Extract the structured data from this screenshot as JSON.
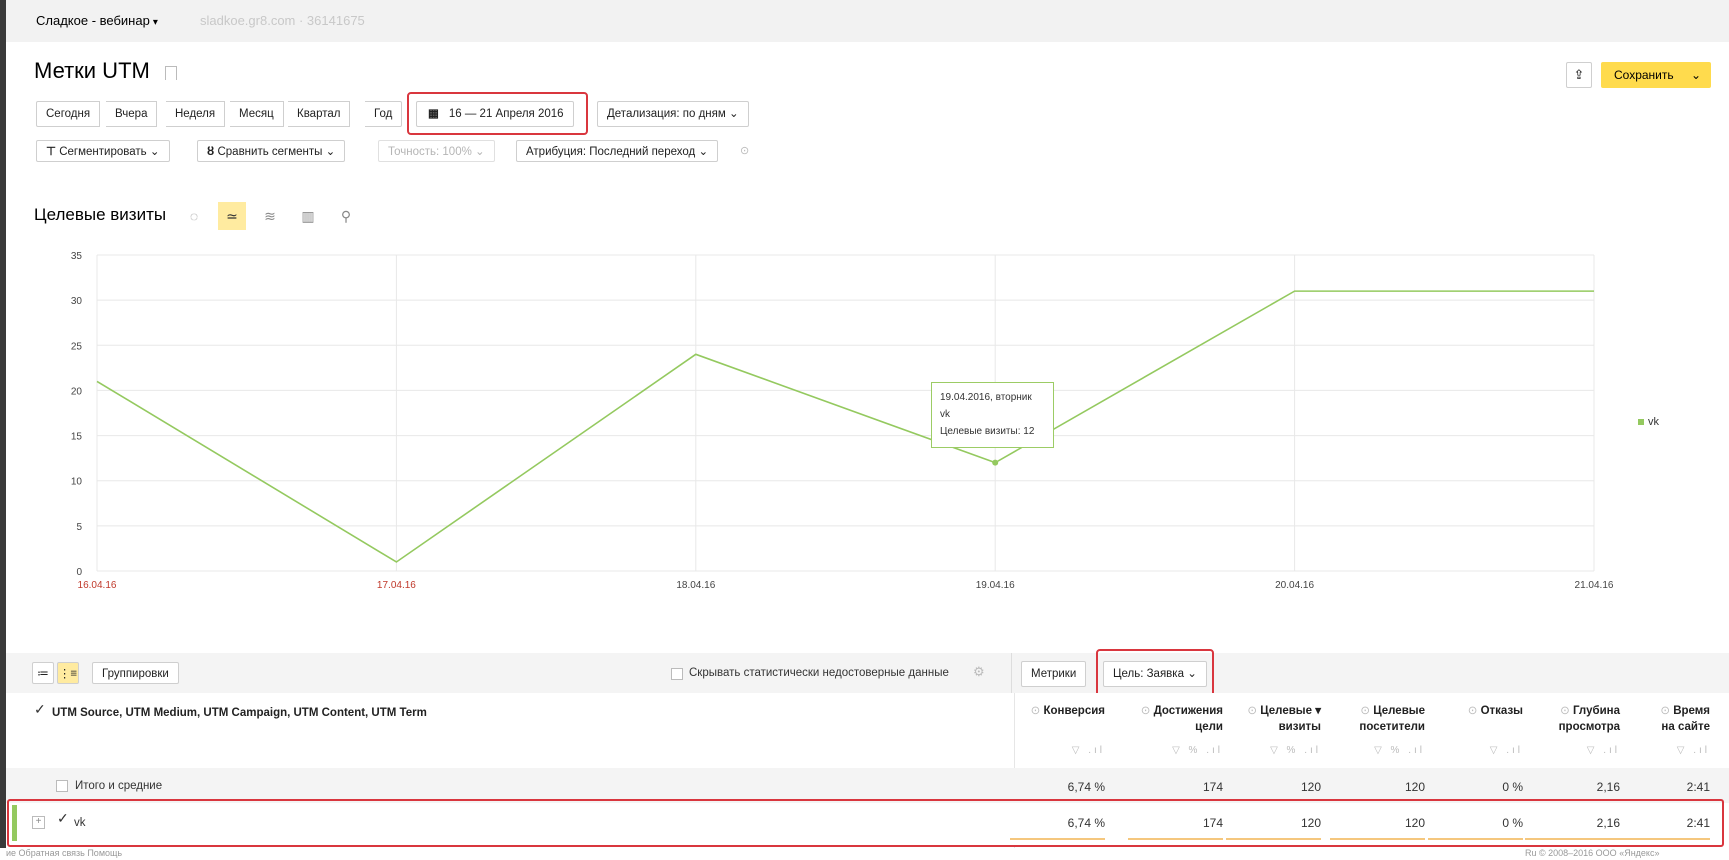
{
  "site": {
    "name": "Сладкое - вебинар",
    "meta": "sladkoe.gr8.com  ·  36141675"
  },
  "page": {
    "title": "Метки UTM"
  },
  "actions": {
    "save_label": "Сохранить"
  },
  "periods": [
    "Сегодня",
    "Вчера",
    "Неделя",
    "Месяц",
    "Квартал",
    "Год"
  ],
  "date_range": "16 — 21 Апреля 2016",
  "detail": "Детализация: по дням",
  "filters": {
    "segment": "Сегментировать",
    "compare": "Сравнить сегменты",
    "accuracy": "Точность: 100%",
    "attribution": "Атрибуция: Последний переход"
  },
  "chart_title": "Целевые визиты",
  "chart_data": {
    "type": "line",
    "x": [
      "16.04.16",
      "17.04.16",
      "18.04.16",
      "19.04.16",
      "20.04.16",
      "21.04.16"
    ],
    "series": [
      {
        "name": "vk",
        "values": [
          21,
          1,
          24,
          12,
          31,
          31
        ]
      }
    ],
    "yticks": [
      0,
      5,
      10,
      15,
      20,
      25,
      30,
      35
    ],
    "ylim": [
      0,
      35
    ],
    "grid": true,
    "legend": "right",
    "weekend_labels": [
      "16.04.16",
      "17.04.16"
    ],
    "colors": {
      "line": "#94c95f",
      "weekend": "#c0392b",
      "grid": "#e8e8e8"
    }
  },
  "tooltip": {
    "line1": "19.04.2016, вторник",
    "line2": "vk",
    "line3": "Целевые визиты: 12"
  },
  "table_toolbar": {
    "groupings": "Группировки",
    "hide_label": "Скрывать статистически недостоверные данные",
    "metrics": "Метрики",
    "goal": "Цель: Заявка"
  },
  "table": {
    "dimension_header": "UTM Source, UTM Medium, UTM Campaign, UTM Content, UTM Term",
    "columns": [
      {
        "l1": "Конверсия",
        "l2": ""
      },
      {
        "l1": "Достижения",
        "l2": "цели"
      },
      {
        "l1": "Целевые ▾",
        "l2": "визиты"
      },
      {
        "l1": "Целевые",
        "l2": "посетители"
      },
      {
        "l1": "Отказы",
        "l2": ""
      },
      {
        "l1": "Глубина",
        "l2": "просмотра"
      },
      {
        "l1": "Время",
        "l2": "на сайте"
      }
    ],
    "col_controls": [
      "▽ .ıl",
      "▽ % .ıl",
      "▽ % .ıl",
      "▽ % .ıl",
      "▽ .ıl",
      "▽ .ıl",
      "▽ .ıl"
    ],
    "total": {
      "label": "Итого и средние",
      "values": [
        "6,74 %",
        "174",
        "120",
        "120",
        "0 %",
        "2,16",
        "2:41"
      ]
    },
    "rows": [
      {
        "label": "vk",
        "values": [
          "6,74 %",
          "174",
          "120",
          "120",
          "0 %",
          "2,16",
          "2:41"
        ]
      }
    ]
  },
  "footer": {
    "left": "ие   Обратная связь   Помощь",
    "right": "Ru   © 2008–2016 ООО «Яндекс»"
  }
}
